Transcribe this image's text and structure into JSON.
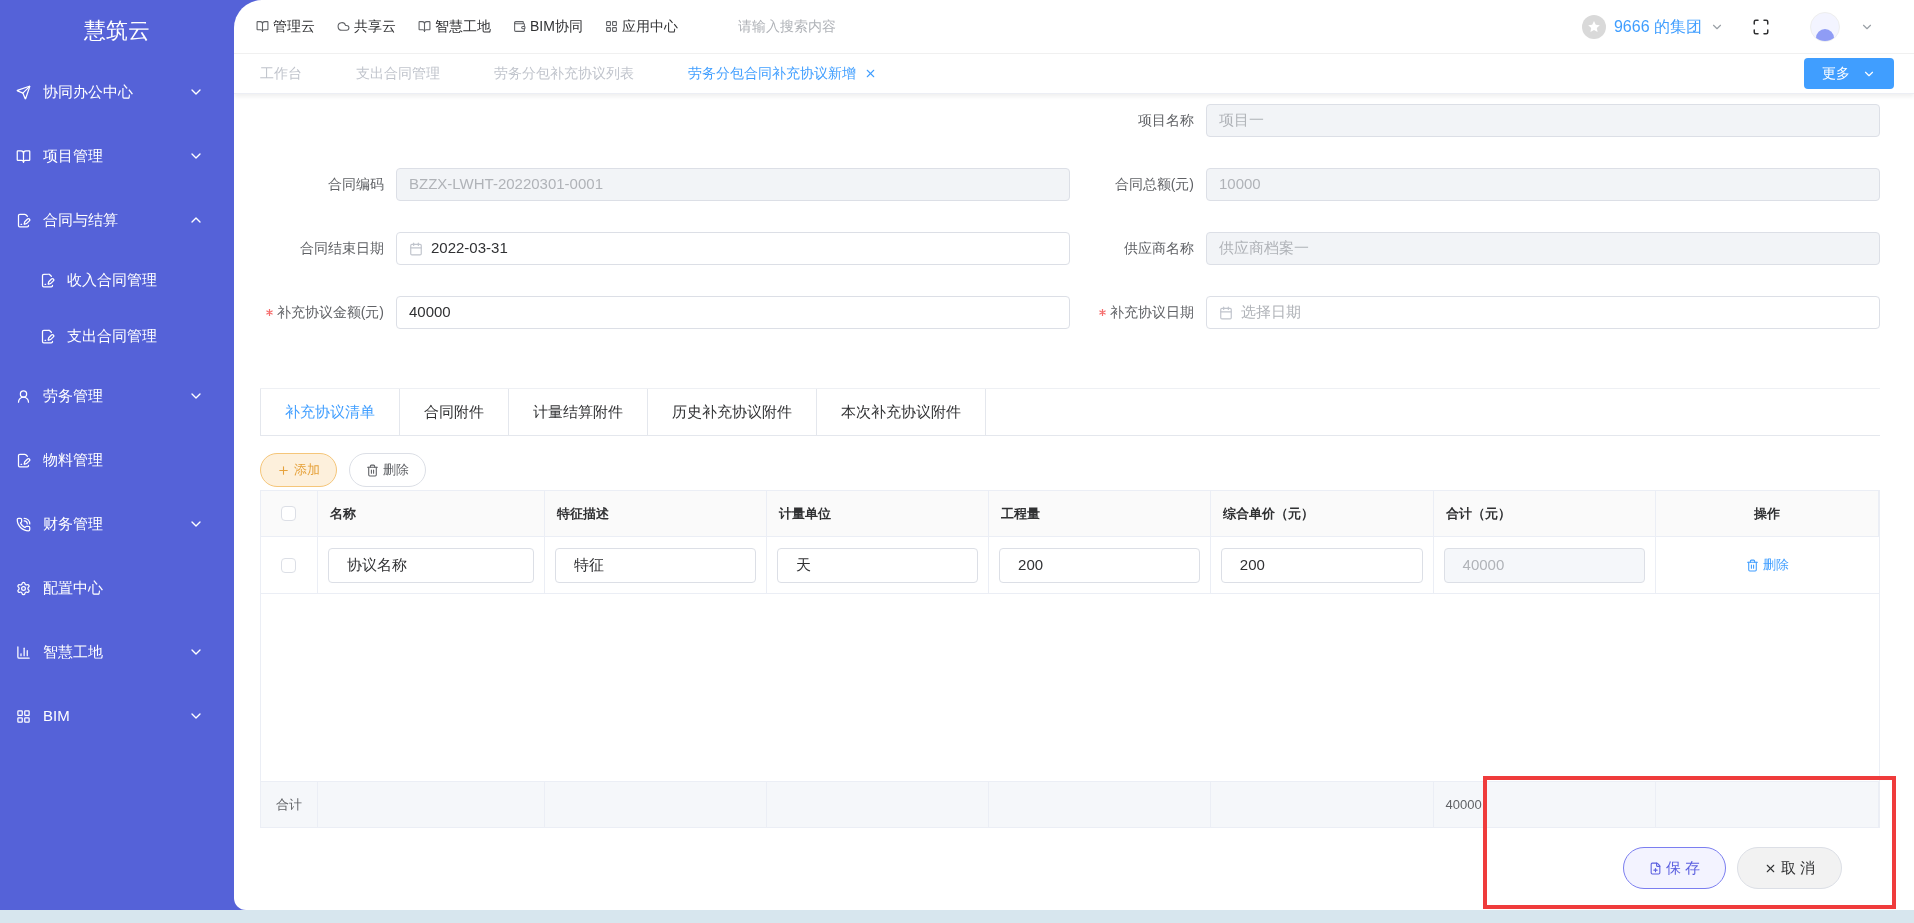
{
  "sidebar": {
    "logo": "慧筑云",
    "items": [
      {
        "label": "协同办公中心",
        "expanded": false
      },
      {
        "label": "项目管理",
        "expanded": false
      },
      {
        "label": "合同与结算",
        "expanded": true,
        "children": [
          {
            "label": "收入合同管理"
          },
          {
            "label": "支出合同管理"
          }
        ]
      },
      {
        "label": "劳务管理",
        "expanded": false
      },
      {
        "label": "物料管理"
      },
      {
        "label": "财务管理",
        "expanded": false
      },
      {
        "label": "配置中心"
      },
      {
        "label": "智慧工地",
        "expanded": false
      },
      {
        "label": "BIM",
        "expanded": false
      }
    ]
  },
  "topbar": {
    "nav": [
      "管理云",
      "共享云",
      "智慧工地",
      "BIM协同",
      "应用中心"
    ],
    "search": {
      "placeholder": "请输入搜索内容"
    },
    "org": "9666 的集团"
  },
  "tabs": [
    {
      "label": "工作台",
      "selected": false,
      "closable": false
    },
    {
      "label": "支出合同管理",
      "selected": false,
      "closable": false
    },
    {
      "label": "劳务分包补充协议列表",
      "selected": false,
      "closable": false
    },
    {
      "label": "劳务分包合同补充协议新增",
      "selected": true,
      "closable": true
    }
  ],
  "more_button": "更多",
  "form": {
    "rows": [
      {
        "right": {
          "label": "项目名称",
          "required": false,
          "kind": "text",
          "value": "项目一",
          "disabled": true
        }
      },
      {
        "left": {
          "label": "合同编码",
          "required": false,
          "kind": "text",
          "value": "BZZX-LWHT-20220301-0001",
          "disabled": true
        },
        "right": {
          "label": "合同总额(元)",
          "required": false,
          "kind": "text",
          "value": "10000",
          "disabled": true
        }
      },
      {
        "left": {
          "label": "合同结束日期",
          "required": false,
          "kind": "date",
          "value": "2022-03-31",
          "disabled": false
        },
        "right": {
          "label": "供应商名称",
          "required": false,
          "kind": "text",
          "value": "供应商档案一",
          "disabled": true
        }
      },
      {
        "left": {
          "label": "补充协议金额(元)",
          "required": true,
          "kind": "text",
          "value": "40000",
          "disabled": false
        },
        "right": {
          "label": "补充协议日期",
          "required": true,
          "kind": "date",
          "placeholder": "选择日期",
          "disabled": false
        }
      }
    ]
  },
  "detail_tabs": [
    {
      "label": "补充协议清单",
      "selected": true
    },
    {
      "label": "合同附件",
      "selected": false
    },
    {
      "label": "计量结算附件",
      "selected": false
    },
    {
      "label": "历史补充协议附件",
      "selected": false
    },
    {
      "label": "本次补充协议附件",
      "selected": false
    }
  ],
  "toolbar": {
    "add": "添加",
    "delete": "删除"
  },
  "table": {
    "header_checked": false,
    "columns": [
      "名称",
      "特征描述",
      "计量单位",
      "工程量",
      "综合单价（元）",
      "合计（元）",
      "操作"
    ],
    "rows": [
      {
        "checked": false,
        "cells": [
          {
            "value": "协议名称",
            "disabled": false
          },
          {
            "value": "特征",
            "disabled": false
          },
          {
            "value": "天",
            "disabled": false
          },
          {
            "value": "200",
            "disabled": false
          },
          {
            "value": "200",
            "disabled": false
          },
          {
            "value": "40000",
            "disabled": true
          }
        ],
        "action": "删除"
      }
    ],
    "summary": {
      "label": "合计",
      "cells": [
        "",
        "",
        "",
        "",
        "",
        "40000",
        ""
      ]
    }
  },
  "footer": {
    "save": "保 存",
    "cancel": "取 消"
  },
  "highlight": true
}
